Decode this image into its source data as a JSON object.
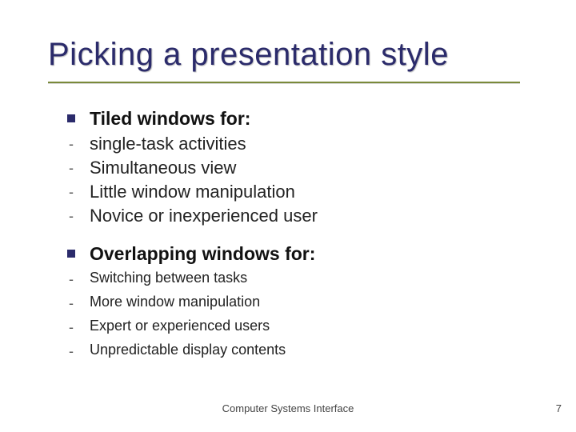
{
  "title": "Picking a presentation style",
  "sections": [
    {
      "heading": "Tiled windows for:",
      "size": "lg",
      "items": [
        "single-task activities",
        "Simultaneous view",
        "Little window manipulation",
        "Novice or inexperienced user"
      ]
    },
    {
      "heading": "Overlapping windows for:",
      "size": "sm",
      "items": [
        "Switching between tasks",
        "More window manipulation",
        "Expert or experienced users",
        "Unpredictable display contents"
      ]
    }
  ],
  "footer": "Computer Systems Interface",
  "page_number": "7",
  "colors": {
    "title": "#2b2b6b",
    "rule": "#7a8a3a",
    "bullet": "#2b2b6b"
  }
}
